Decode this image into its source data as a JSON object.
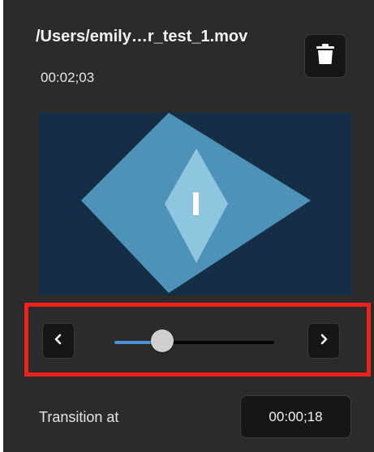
{
  "clip": {
    "file_path": "/Users/emily…r_test_1.mov",
    "duration": "00:02;03"
  },
  "icons": {
    "delete": "trash-icon",
    "previous": "chevron-left-icon",
    "next": "chevron-right-icon"
  },
  "scrubber": {
    "position_fraction": 0.3
  },
  "transition": {
    "label": "Transition at",
    "value": "00:00;18"
  },
  "colors": {
    "panel_background": "#2b2b2b",
    "preview_background": "#142f45",
    "preview_outer_diamond": "#4f92b8",
    "preview_mid_diamond": "#8ec6df",
    "preview_center": "#ffffff",
    "slider_fill": "#4f8fd6",
    "highlight_border": "#f0211b"
  }
}
